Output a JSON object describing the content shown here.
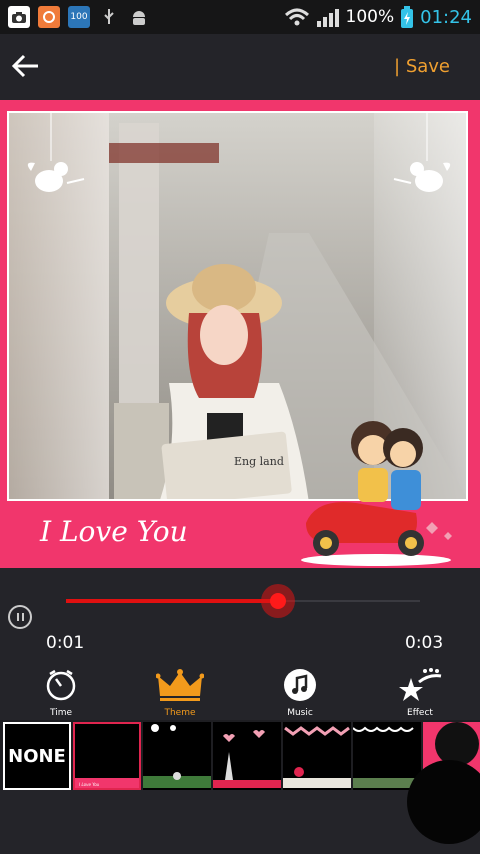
{
  "status": {
    "battery": "100%",
    "time": "01:24",
    "battery_badge": "100"
  },
  "appbar": {
    "save_label": "| Save"
  },
  "frame": {
    "caption": "I Love You",
    "newspaper_text": "Eng land"
  },
  "player": {
    "current": "0:01",
    "total": "0:03",
    "progress": 0.6
  },
  "tabs": [
    {
      "label": "Time",
      "icon": "clock-icon"
    },
    {
      "label": "Theme",
      "icon": "crown-icon"
    },
    {
      "label": "Music",
      "icon": "music-icon"
    },
    {
      "label": "Effect",
      "icon": "effect-star-icon"
    }
  ],
  "themes": {
    "none_label": "NONE",
    "thumb_caption": "I Love You"
  },
  "colors": {
    "accent": "#f1366c",
    "save": "#f0a030",
    "progress": "#e01010",
    "time": "#34c3e8"
  }
}
